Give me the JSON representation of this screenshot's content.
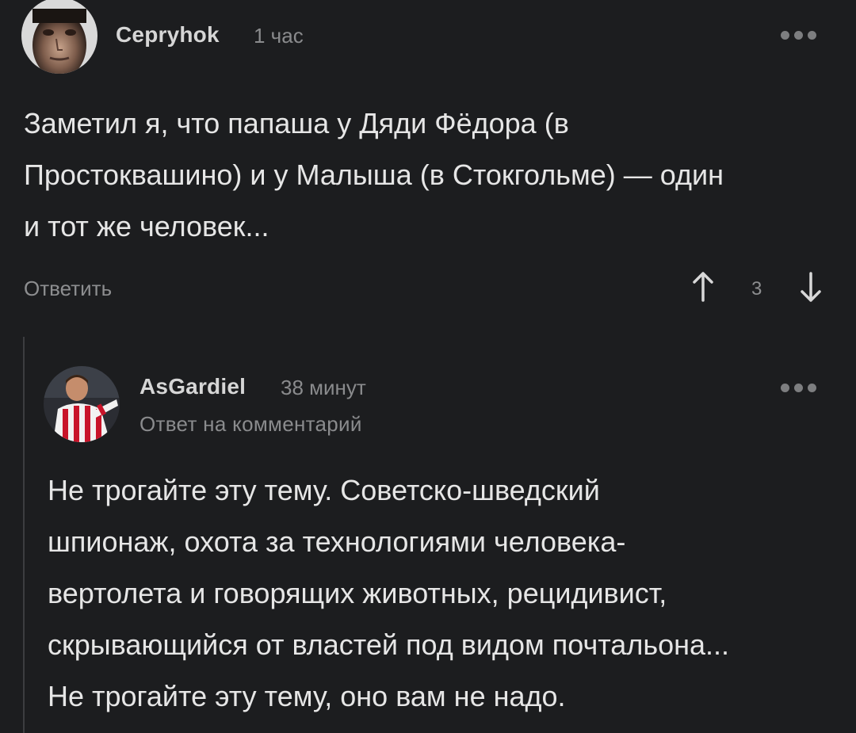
{
  "comment": {
    "author": "Cepryhok",
    "time": "1 час",
    "text_lines": [
      "Заметил я, что папаша у Дяди Фёдора (в",
      "Простоквашино) и у Малыша (в Стокгольме) — один",
      "и тот же человек..."
    ],
    "reply_label": "Ответить",
    "rating": "3",
    "avatar_icon": "user-avatar-icon",
    "more_icon": "more-dots-icon",
    "upvote_icon": "arrow-up-icon",
    "downvote_icon": "arrow-down-icon"
  },
  "reply": {
    "author": "AsGardiel",
    "time": "38 минут",
    "subtitle": "Ответ на комментарий",
    "text_lines": [
      "Не трогайте эту тему. Советско-шведский",
      "шпионаж, охота за технологиями человека-",
      "вертолета и говорящих животных, рецидивист,",
      "скрывающийся от властей под видом почтальона...",
      "Не трогайте эту тему, оно вам не надо."
    ],
    "avatar_icon": "user-avatar-icon",
    "more_icon": "more-dots-icon"
  },
  "colors": {
    "background": "#1c1d1f",
    "text": "#e6e6e6",
    "muted": "#8a8b8d",
    "thread_line": "#3c3d40"
  }
}
